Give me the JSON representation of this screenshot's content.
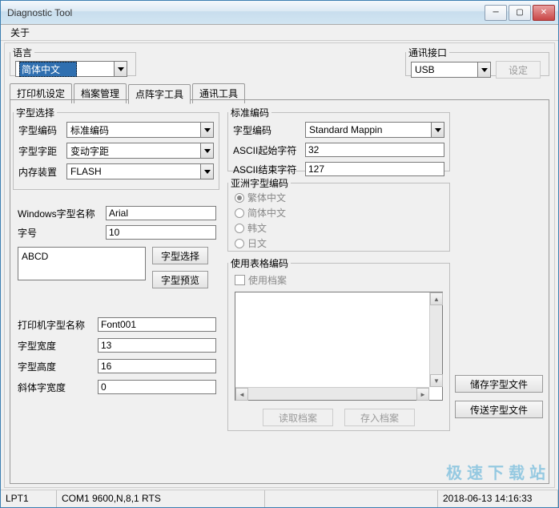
{
  "window": {
    "title": "Diagnostic Tool"
  },
  "menu": {
    "about": "关于"
  },
  "lang_group": {
    "legend": "语言",
    "value": "简体中文"
  },
  "comm_group": {
    "legend": "通讯接口",
    "value": "USB",
    "set_btn": "设定"
  },
  "tabs": {
    "t0": "打印机设定",
    "t1": "档案管理",
    "t2": "点阵字工具",
    "t3": "通讯工具"
  },
  "font_select": {
    "legend": "字型选择",
    "encode_label": "字型编码",
    "encode_val": "标准编码",
    "pitch_label": "字型字距",
    "pitch_val": "变动字距",
    "storage_label": "内存装置",
    "storage_val": "FLASH"
  },
  "win_font": {
    "name_label": "Windows字型名称",
    "name_val": "Arial",
    "size_label": "字号",
    "size_val": "10",
    "sample": "ABCD",
    "btn_select": "字型选择",
    "btn_preview": "字型预览"
  },
  "printer_font": {
    "name_label": "打印机字型名称",
    "name_val": "Font001",
    "width_label": "字型宽度",
    "width_val": "13",
    "height_label": "字型高度",
    "height_val": "16",
    "italic_label": "斜体字宽度",
    "italic_val": "0"
  },
  "std_code": {
    "legend": "标准编码",
    "encode_label": "字型编码",
    "encode_val": "Standard Mappin",
    "ascii_start_label": "ASCII起始字符",
    "ascii_start_val": "32",
    "ascii_end_label": "ASCII结束字符",
    "ascii_end_val": "127"
  },
  "asia": {
    "legend": "亚洲字型编码",
    "r0": "繁体中文",
    "r1": "简体中文",
    "r2": "韩文",
    "r3": "日文"
  },
  "table_code": {
    "legend": "使用表格编码",
    "use_file": "使用档案",
    "btn_read": "读取档案",
    "btn_save": "存入档案"
  },
  "right_btns": {
    "save_font": "储存字型文件",
    "send_font": "传送字型文件"
  },
  "status": {
    "port": "LPT1",
    "conn": "COM1 9600,N,8,1 RTS",
    "dt": "2018-06-13 14:16:33"
  },
  "watermark": "极速下载站"
}
